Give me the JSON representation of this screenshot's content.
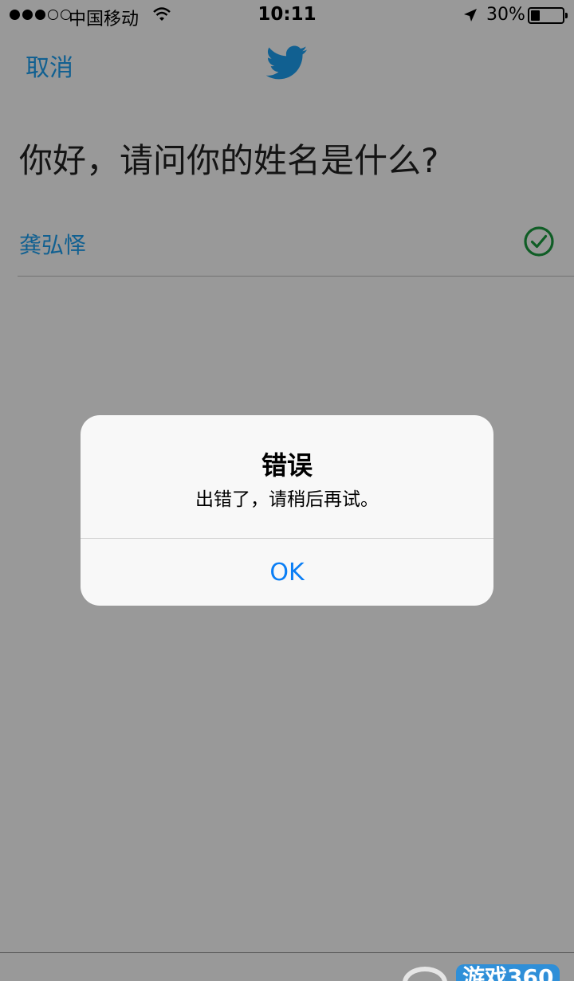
{
  "status_bar": {
    "carrier": "中国移动",
    "time": "10:11",
    "battery": "30%"
  },
  "nav": {
    "cancel_label": "取消",
    "logo_icon": "twitter-bird-icon"
  },
  "form": {
    "question": "你好，请问你的姓名是什么?",
    "name_value": "龚弘怿",
    "valid_icon": "check-circle-icon"
  },
  "alert": {
    "title": "错误",
    "message": "出错了，请稍后再试。",
    "ok_label": "OK"
  },
  "watermark": {
    "text": "游戏360"
  },
  "colors": {
    "accent": "#1da1f2",
    "check": "#1a9c3e",
    "alert_button": "#0a7ef5"
  }
}
